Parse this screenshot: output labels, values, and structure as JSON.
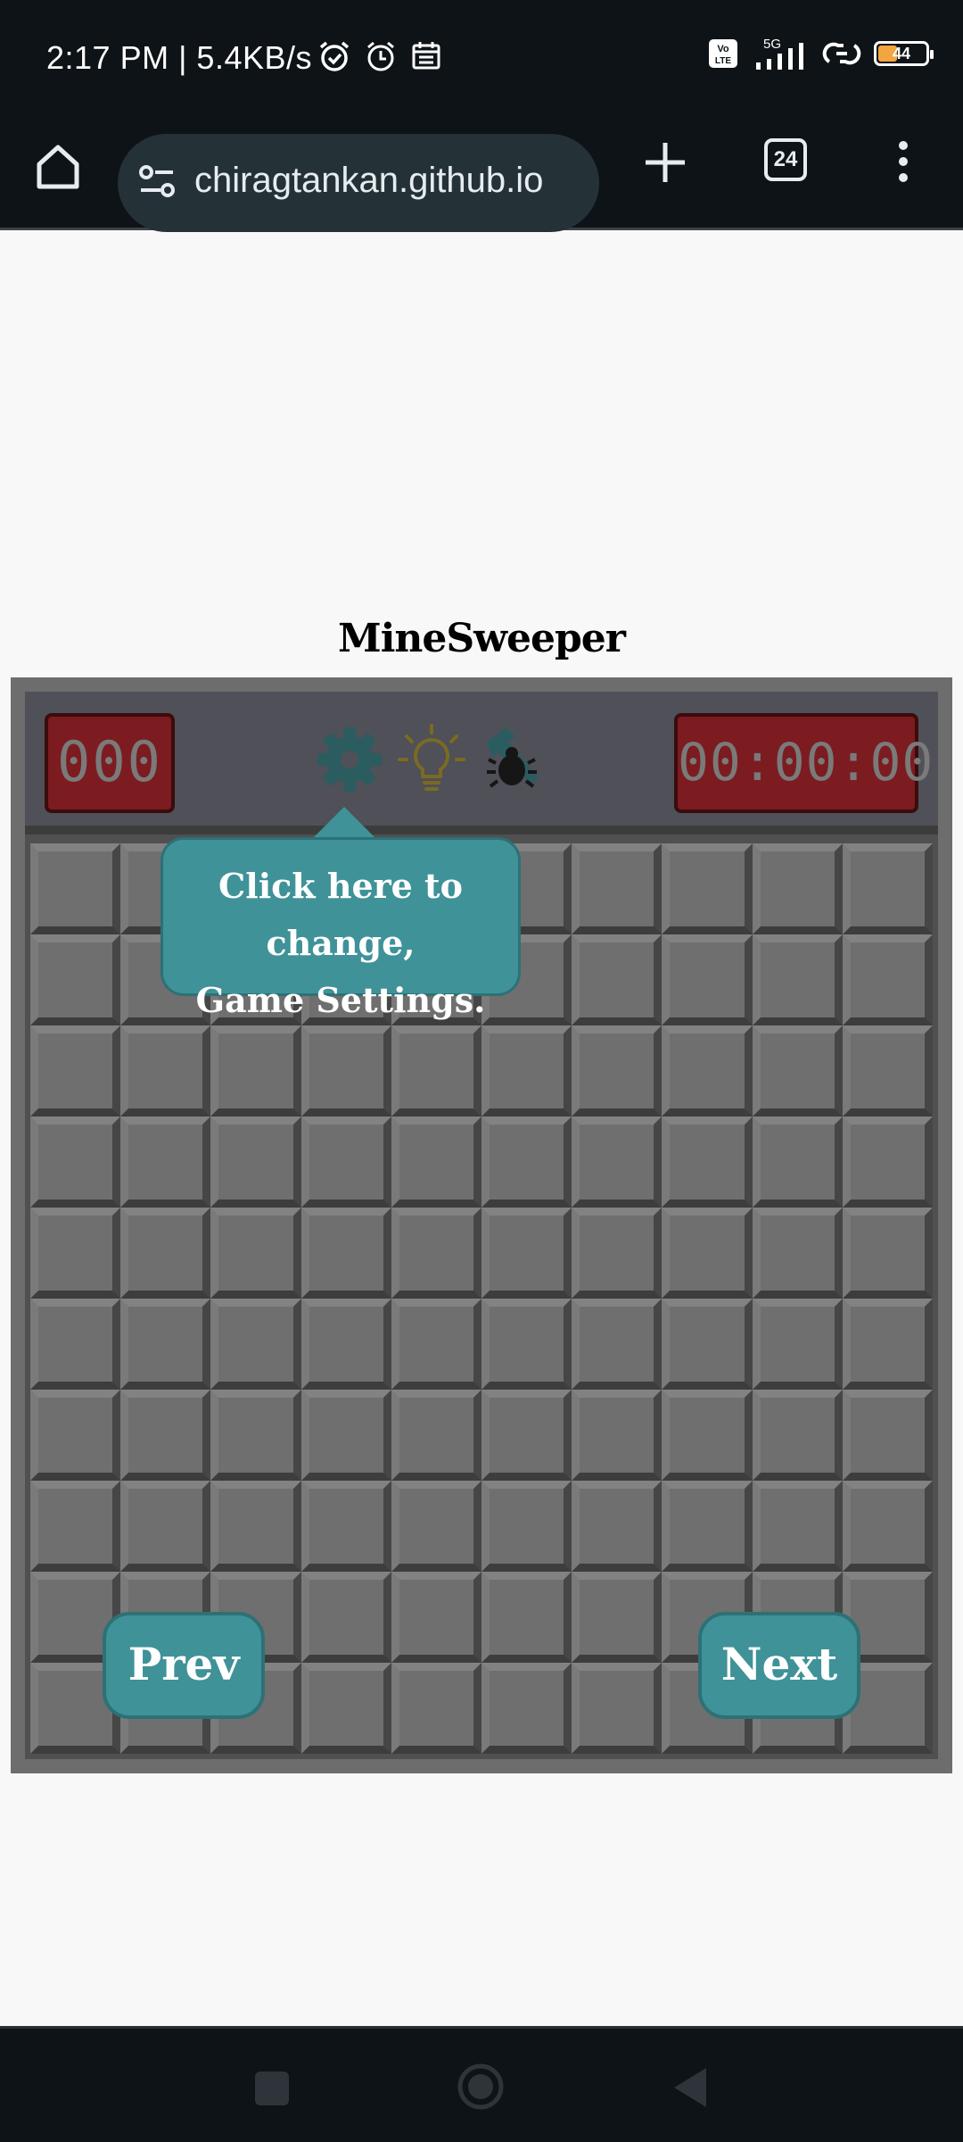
{
  "status_bar": {
    "time_speed": "2:17 PM | 5.4KB/s",
    "icons_left": [
      "alarm-clock-icon",
      "alarm-icon",
      "calendar-icon"
    ],
    "icons_right": [
      "volte-icon",
      "5g-signal-icon",
      "link-icon",
      "battery-icon"
    ],
    "volte_label": "Vo LTE",
    "network": "5G",
    "battery_pct": "44"
  },
  "browser": {
    "url": "chiragtankan.github.io",
    "tab_count": "24"
  },
  "game": {
    "title": "MineSweeper",
    "mine_counter": "000",
    "timer": "00:00:00",
    "grid": {
      "rows": 10,
      "cols": 10
    },
    "tools": [
      "settings-gear-icon",
      "hint-lightbulb-icon",
      "debug-hammer-icon"
    ]
  },
  "tutorial": {
    "tooltip_line1": "Click here to change,",
    "tooltip_line2": "Game Settings.",
    "prev_label": "Prev",
    "next_label": "Next"
  },
  "colors": {
    "teal": "#3f9298",
    "counter_red": "#7c1c20",
    "browser_bg": "#0e1317"
  }
}
